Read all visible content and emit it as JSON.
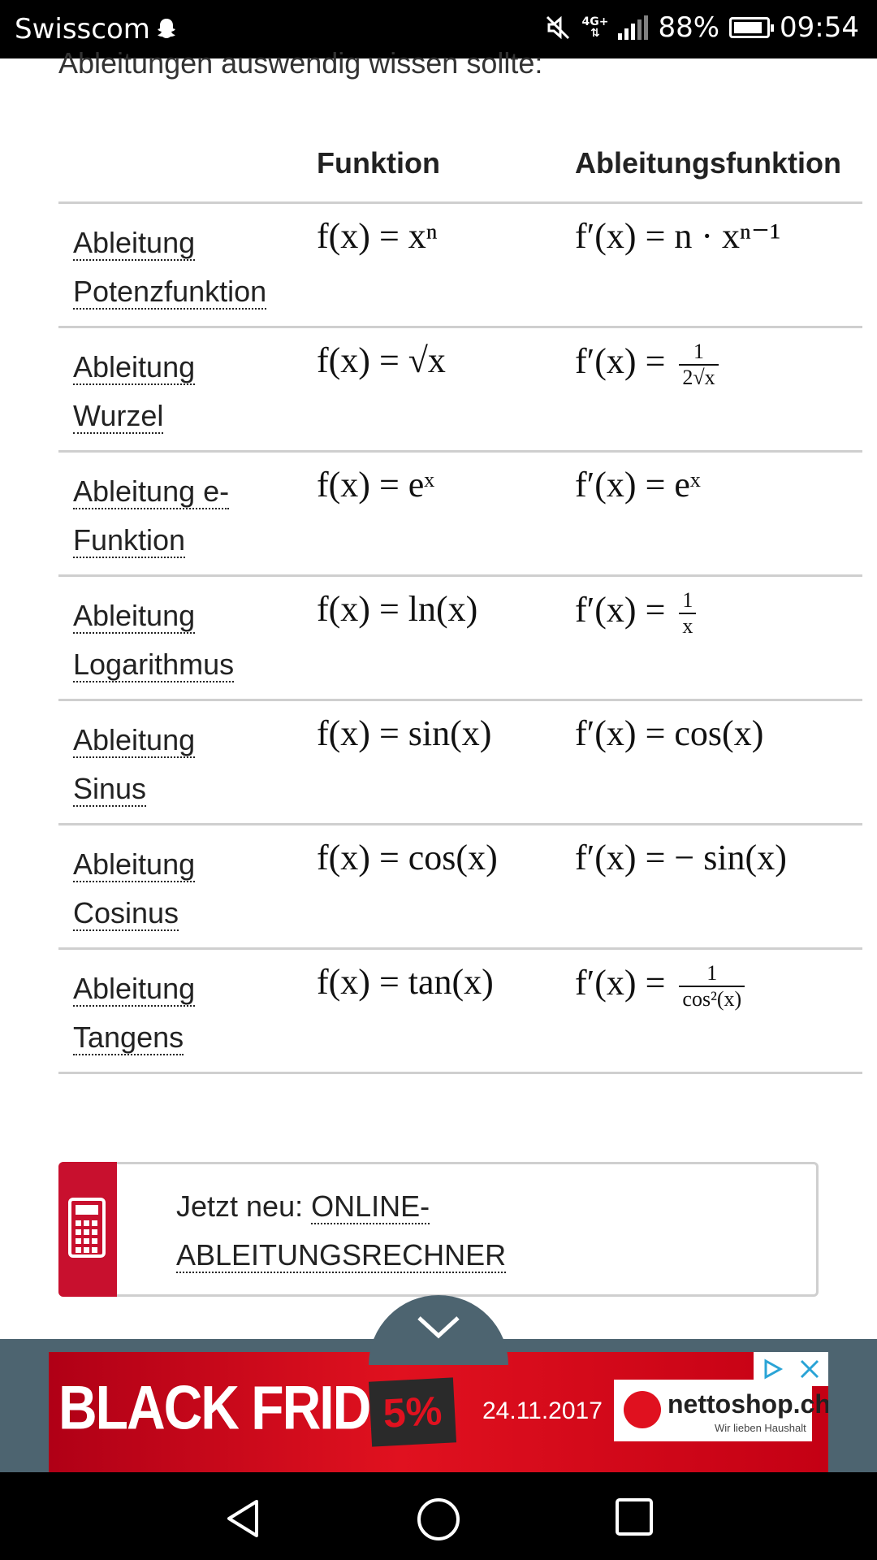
{
  "status_bar": {
    "carrier": "Swisscom",
    "network": "4G+",
    "battery": "88%",
    "time": "09:54"
  },
  "intro_text": "Ableitungen auswendig wissen sollte:",
  "table": {
    "headers": [
      "",
      "Funktion",
      "Ableitungsfunktion"
    ],
    "rows": [
      {
        "name1": "Ableitung",
        "name2": "Potenzfunktion",
        "func": "f(x) = xⁿ",
        "deriv": "f′(x) = n · xⁿ⁻¹"
      },
      {
        "name1": "Ableitung",
        "name2": "Wurzel",
        "func": "f(x) = √x",
        "deriv_prefix": "f′(x) =",
        "deriv_num": "1",
        "deriv_den": "2√x"
      },
      {
        "name1": "Ableitung e-",
        "name2": "Funktion",
        "func": "f(x) = eˣ",
        "deriv": "f′(x) = eˣ"
      },
      {
        "name1": "Ableitung",
        "name2": "Logarithmus",
        "func": "f(x) = ln(x)",
        "deriv_prefix": "f′(x) =",
        "deriv_num": "1",
        "deriv_den": "x"
      },
      {
        "name1": "Ableitung",
        "name2": "Sinus",
        "func": "f(x) = sin(x)",
        "deriv": "f′(x) = cos(x)"
      },
      {
        "name1": "Ableitung",
        "name2": "Cosinus",
        "func": "f(x) = cos(x)",
        "deriv": "f′(x) = − sin(x)"
      },
      {
        "name1": "Ableitung",
        "name2": "Tangens",
        "func": "f(x) = tan(x)",
        "deriv_prefix": "f′(x) =",
        "deriv_num": "1",
        "deriv_den": "cos²(x)"
      }
    ]
  },
  "callout": {
    "prefix": "Jetzt neu: ",
    "link_line1": "ONLINE-",
    "link_line2": "ABLEITUNGSRECHNER",
    "icon": "calculator-icon"
  },
  "ad": {
    "headline": "BLACK FRIDAY",
    "discount": "5%",
    "date": "24.11.2017",
    "brand": "nettoshop.ch",
    "slogan": "Wir lieben Haushalt"
  },
  "colors": {
    "accent_red": "#c8102e",
    "ad_bg": "#4d6470"
  }
}
